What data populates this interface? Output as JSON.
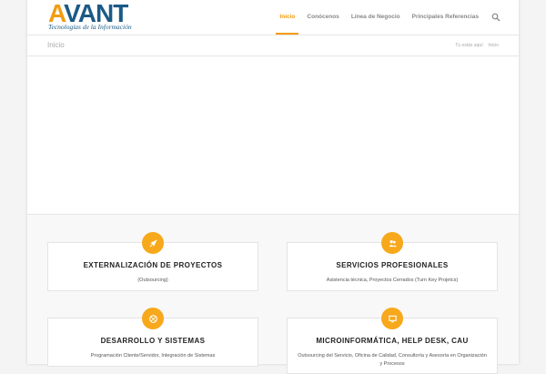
{
  "brand": {
    "logo_text_a": "A",
    "logo_text_rest": "VANT",
    "tagline": "Tecnologías de la Información",
    "accent": "#f39c12",
    "logo_color": "#1b5a86"
  },
  "nav": {
    "items": [
      {
        "label": "Inicio",
        "active": true
      },
      {
        "label": "Conócenos",
        "active": false
      },
      {
        "label": "Línea de Negocio",
        "active": false
      },
      {
        "label": "Principales Referencias",
        "active": false
      }
    ],
    "search_icon": "search-icon"
  },
  "breadcrumb": {
    "title": "Inicio",
    "prefix": "Tú estás aquí:",
    "current": "Inicio"
  },
  "services": [
    {
      "title": "EXTERNALIZACIÓN DE PROYECTOS",
      "desc": "(Outsourcing)",
      "icon": "rocket-icon"
    },
    {
      "title": "SERVICIOS PROFESIONALES",
      "desc": "Asistencia técnica, Proyectos Cerrados (Turn Key Projetcs)",
      "icon": "users-icon"
    },
    {
      "title": "DESARROLLO Y SISTEMAS",
      "desc": "Programación Cliente/Servidor, Integración de Sistemas",
      "icon": "basketball-icon"
    },
    {
      "title": "MICROINFORMÁTICA, HELP DESK, CAU",
      "desc": "Outsourcing del Servicio, Oficina de Calidad, Consultoría y Asesoría en Organización y Procesos",
      "icon": "monitor-icon"
    }
  ]
}
